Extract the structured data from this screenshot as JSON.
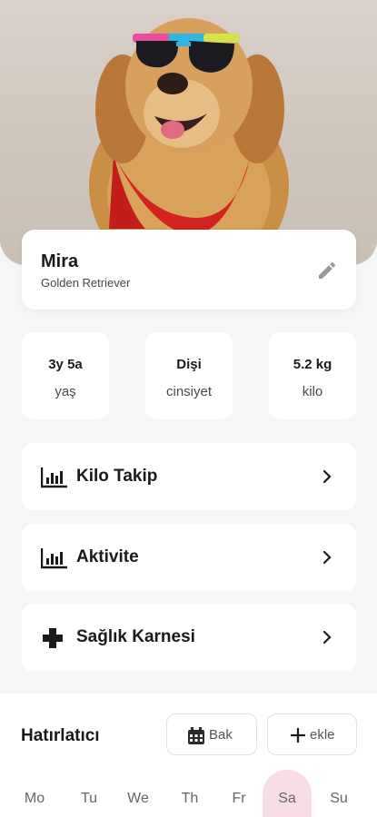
{
  "pet": {
    "name": "Mira",
    "breed": "Golden Retriever"
  },
  "stats": [
    {
      "value": "3y 5a",
      "label": "yaş"
    },
    {
      "value": "Dişi",
      "label": "cinsiyet"
    },
    {
      "value": "5.2 kg",
      "label": "kilo"
    }
  ],
  "menu": [
    {
      "label": "Kilo Takip",
      "icon": "bar-chart-icon"
    },
    {
      "label": "Aktivite",
      "icon": "bar-chart-icon"
    },
    {
      "label": "Sağlık Karnesi",
      "icon": "medical-cross-icon"
    }
  ],
  "reminder": {
    "title": "Hatırlatıcı",
    "view_label": "Bak",
    "add_label": "ekle"
  },
  "days": [
    "Mo",
    "Tu",
    "We",
    "Th",
    "Fr",
    "Sa",
    "Su"
  ],
  "selected_day": "Sa",
  "colors": {
    "background": "#f5f6f8",
    "card": "#ffffff",
    "selected_day": "#f9dde6"
  }
}
